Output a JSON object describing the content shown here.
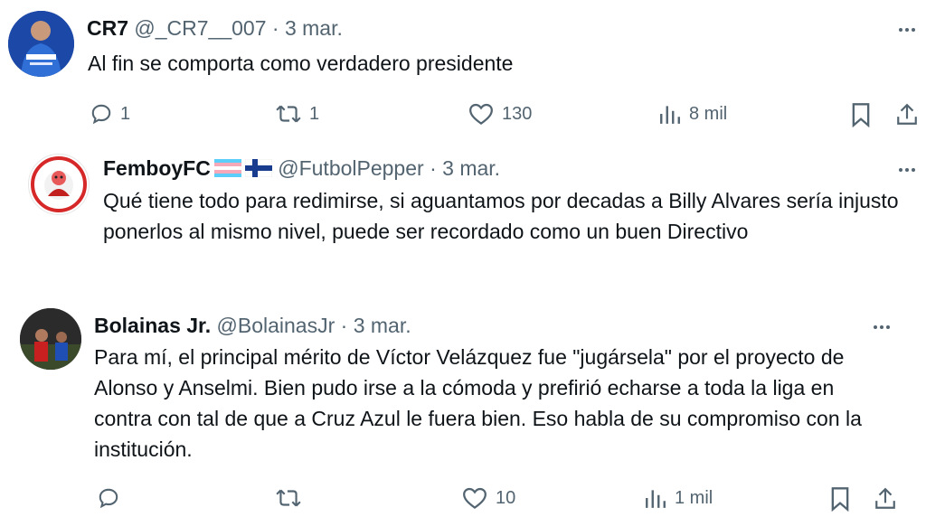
{
  "tweets": [
    {
      "name": "CR7",
      "handle": "@_CR7__007",
      "sep": "·",
      "date": "3 mar.",
      "text": "Al fin se comporta como verdadero presidente",
      "replies": "1",
      "retweets": "1",
      "likes": "130",
      "views": "8 mil"
    },
    {
      "name": "FemboyFC",
      "handle": "@FutbolPepper",
      "sep": "·",
      "date": "3 mar.",
      "text": "Qué tiene todo para redimirse, si aguantamos por decadas a Billy Alvares sería injusto ponerlos al mismo nivel, puede ser recordado como un buen Directivo",
      "name_emoji": [
        "transgender-flag-icon",
        "finland-flag-icon"
      ]
    },
    {
      "name": "Bolainas Jr.",
      "handle": "@BolainasJr",
      "sep": "·",
      "date": "3 mar.",
      "text": "Para mí, el principal mérito de Víctor Velázquez fue \"jugársela\" por el proyecto de Alonso y Anselmi. Bien pudo irse a la cómoda y prefirió echarse a toda la liga en contra con tal de que a Cruz Azul le fuera bien. Eso habla de su compromiso con la institución.",
      "replies": "",
      "retweets": "",
      "likes": "10",
      "views": "1 mil"
    }
  ],
  "colors": {
    "text": "#0f1419",
    "muted": "#536471",
    "background": "#ffffff"
  },
  "icons": [
    "reply-icon",
    "retweet-icon",
    "like-icon",
    "views-icon",
    "bookmark-icon",
    "share-icon",
    "more-icon"
  ]
}
